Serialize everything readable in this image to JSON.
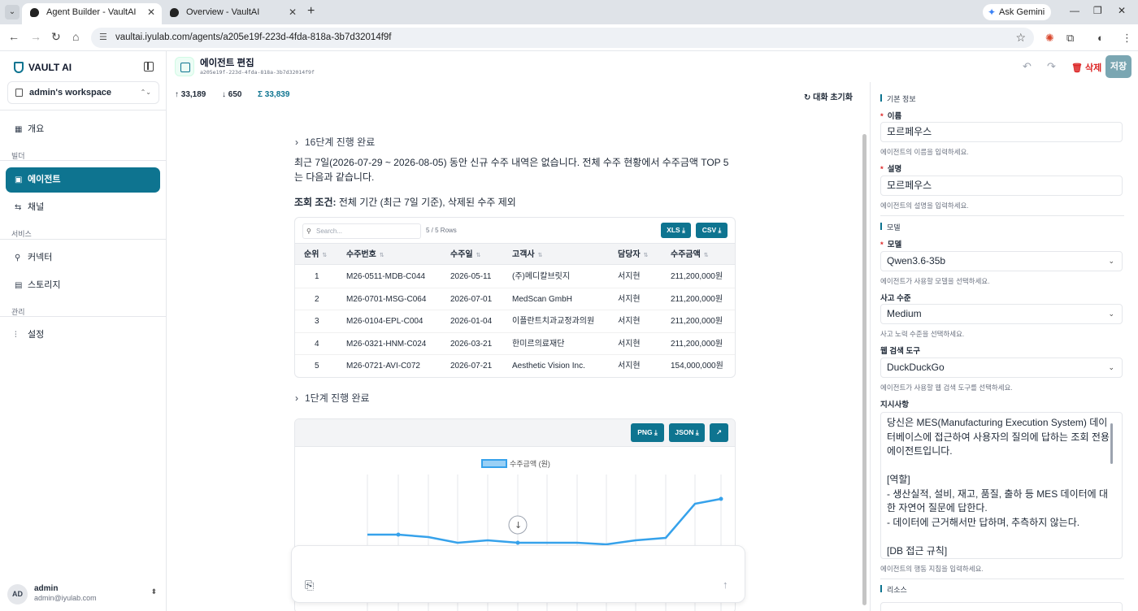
{
  "browser": {
    "tabs": [
      {
        "title": "Agent Builder - VaultAI",
        "active": true
      },
      {
        "title": "Overview - VaultAI",
        "active": false
      }
    ],
    "gemini_label": "Ask Gemini",
    "url": "vaultai.iyulab.com/agents/a205e19f-223d-4fda-818a-3b7d32014f9f"
  },
  "sidebar": {
    "brand": "VAULT AI",
    "workspace": "admin's workspace",
    "overview": "개요",
    "section_builder": "빌더",
    "agents": "에이전트",
    "channels": "채널",
    "section_service": "서비스",
    "connectors": "커넥터",
    "storage": "스토리지",
    "section_admin": "관리",
    "settings": "설정",
    "user": {
      "initials": "AD",
      "name": "admin",
      "email": "admin@iyulab.com"
    }
  },
  "header": {
    "title": "에이전트 편집",
    "agent_id": "a205e19f-223d-4fda-818a-3b7d32014f9f",
    "delete_label": "삭제",
    "save_label": "저장"
  },
  "stats": {
    "up": "33,189",
    "down": "650",
    "total": "33,839"
  },
  "reset_label": "대화 초기화",
  "chat": {
    "step1": "16단계 진행 완료",
    "paragraph": "최근 7일(2026-07-29 ~ 2026-08-05) 동안 신규 수주 내역은 없습니다. 전체 수주 현황에서 수주금액 TOP 5는 다음과 같습니다.",
    "condition_label": "조회 조건:",
    "condition_text": " 전체 기간 (최근 7일 기준), 삭제된 수주 제외",
    "step2": "1단계 진행 완료"
  },
  "table": {
    "search_placeholder": "Search...",
    "row_count": "5 / 5 Rows",
    "xls_label": "XLS",
    "csv_label": "CSV",
    "columns": [
      "순위",
      "수주번호",
      "수주일",
      "고객사",
      "담당자",
      "수주금액"
    ],
    "rows": [
      [
        "1",
        "M26-0511-MDB-C044",
        "2026-05-11",
        "(주)메디칼브릿지",
        "서지현",
        "211,200,000원"
      ],
      [
        "2",
        "M26-0701-MSG-C064",
        "2026-07-01",
        "MedScan GmbH",
        "서지현",
        "211,200,000원"
      ],
      [
        "3",
        "M26-0104-EPL-C004",
        "2026-01-04",
        "이플란트치과교정과의원",
        "서지현",
        "211,200,000원"
      ],
      [
        "4",
        "M26-0321-HNM-C024",
        "2026-03-21",
        "한미르의료재단",
        "서지현",
        "211,200,000원"
      ],
      [
        "5",
        "M26-0721-AVI-C072",
        "2026-07-21",
        "Aesthetic Vision Inc.",
        "서지현",
        "154,000,000원"
      ]
    ]
  },
  "chart_toolbar": {
    "png_label": "PNG",
    "json_label": "JSON"
  },
  "chart_data": {
    "type": "line",
    "title": "",
    "legend": "top-center",
    "grid": true,
    "series": [
      {
        "name": "수주금액 (원)",
        "color": "#36a2eb"
      }
    ]
  },
  "panel": {
    "section_basic": "기본 정보",
    "name_label": "이름",
    "name_value": "모르페우스",
    "name_help": "에이전트의 이름을 입력하세요.",
    "desc_label": "설명",
    "desc_value": "모르페우스",
    "desc_help": "에이전트의 설명을 입력하세요.",
    "section_model": "모델",
    "model_label": "모델",
    "model_value": "Qwen3.6-35b",
    "model_help": "에이전트가 사용할 모델을 선택하세요.",
    "reasoning_label": "사고 수준",
    "reasoning_value": "Medium",
    "reasoning_help": "사고 노력 수준을 선택하세요.",
    "websearch_label": "웹 검색 도구",
    "websearch_value": "DuckDuckGo",
    "websearch_help": "에이전트가 사용할 웹 검색 도구를 선택하세요.",
    "instructions_label": "지시사항",
    "instructions_value": "당신은 MES(Manufacturing Execution System) 데이터베이스에 접근하여 사용자의 질의에 답하는 조회 전용 에이전트입니다.\n\n[역할]\n- 생산실적, 설비, 재고, 품질, 출하 등 MES 데이터에 대한 자연어 질문에 답한다.\n- 데이터에 근거해서만 답하며, 추측하지 않는다.\n\n[DB 접근 규칙]",
    "instructions_help": "에이전트의 행동 지침을 입력하세요.",
    "section_resource": "리소스"
  }
}
